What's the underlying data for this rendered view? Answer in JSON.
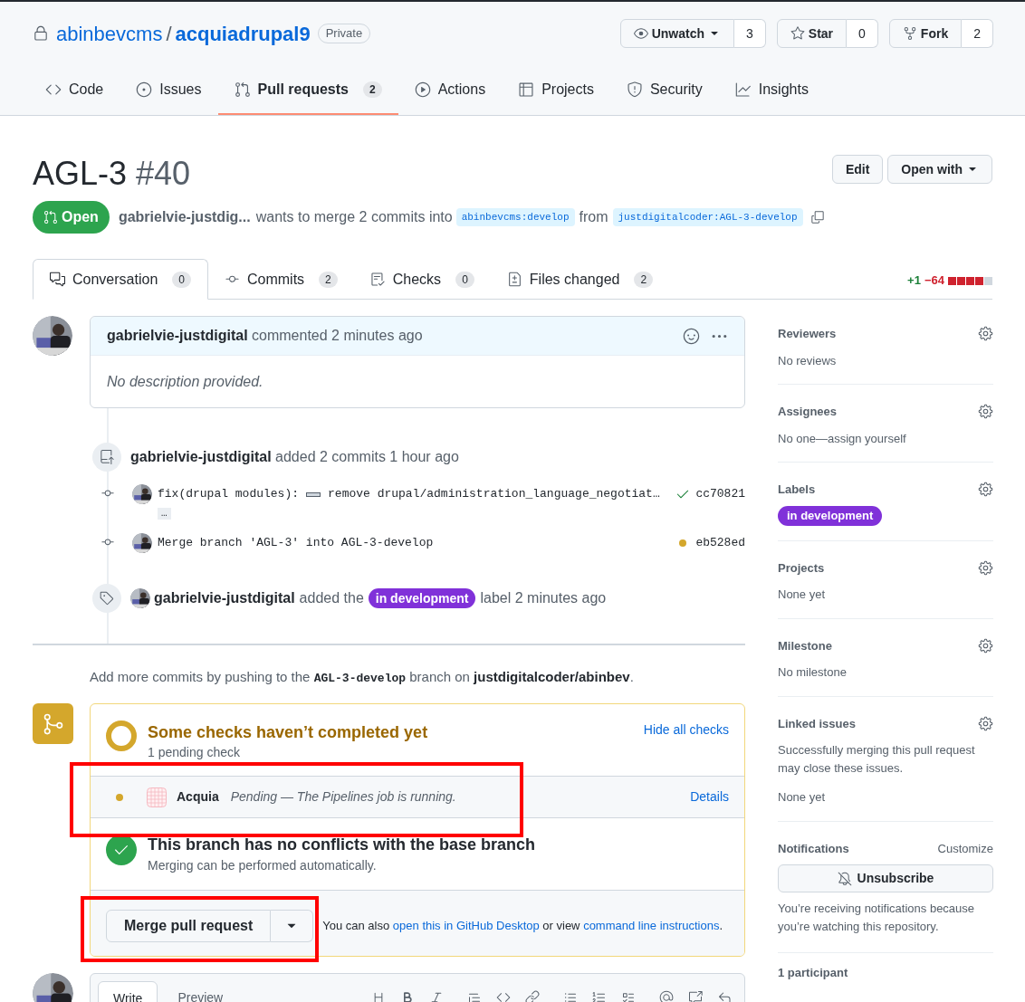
{
  "repo": {
    "owner": "abinbevcms",
    "separator": "/",
    "name": "acquiadrupal9",
    "visibility": "Private"
  },
  "repo_actions": [
    {
      "kind": "watch",
      "label": "Unwatch",
      "count": "3"
    },
    {
      "kind": "star",
      "label": "Star",
      "count": "0"
    },
    {
      "kind": "fork",
      "label": "Fork",
      "count": "2"
    }
  ],
  "repo_tabs": [
    {
      "kind": "code",
      "label": "Code",
      "selected": false
    },
    {
      "kind": "issues",
      "label": "Issues",
      "selected": false
    },
    {
      "kind": "pulls",
      "label": "Pull requests",
      "count": "2",
      "selected": true
    },
    {
      "kind": "actions",
      "label": "Actions",
      "selected": false
    },
    {
      "kind": "projects",
      "label": "Projects",
      "selected": false
    },
    {
      "kind": "security",
      "label": "Security",
      "selected": false
    },
    {
      "kind": "insights",
      "label": "Insights",
      "selected": false
    }
  ],
  "pr": {
    "title": "AGL-3",
    "number": "#40",
    "status": "Open",
    "author": "gabrielvie-justdig...",
    "merge_text": "wants to merge 2 commits into",
    "base": "abinbevcms:develop",
    "from_text": "from",
    "head": "justdigitalcoder:AGL-3-develop",
    "edit_button": "Edit",
    "open_with_button": "Open with"
  },
  "pr_tabs": [
    {
      "kind": "conversation",
      "label": "Conversation",
      "count": "0",
      "selected": true
    },
    {
      "kind": "commits",
      "label": "Commits",
      "count": "2",
      "selected": false
    },
    {
      "kind": "checks",
      "label": "Checks",
      "count": "0",
      "selected": false
    },
    {
      "kind": "files",
      "label": "Files changed",
      "count": "2",
      "selected": false
    }
  ],
  "diffstat": {
    "additions": "+1",
    "deletions": "−64",
    "blocks": [
      {
        "kind": "deleted"
      },
      {
        "kind": "deleted"
      },
      {
        "kind": "deleted"
      },
      {
        "kind": "deleted"
      },
      {
        "kind": "neutral"
      }
    ]
  },
  "comment": {
    "author": "gabrielvie-justdigital",
    "action": "commented 2 minutes ago",
    "body": "No description provided."
  },
  "commits_event": {
    "author": "gabrielvie-justdigital",
    "text": "added 2 commits 1 hour ago"
  },
  "commits": [
    {
      "message_prefix": "fix(drupal modules):",
      "message": "remove drupal/administration_language_negotiat…",
      "more": "…",
      "kind": "success",
      "sha": "cc70821"
    },
    {
      "message": "Merge branch 'AGL-3' into AGL-3-develop",
      "kind": "pending",
      "sha": "eb528ed"
    }
  ],
  "label_event": {
    "author": "gabrielvie-justdigital",
    "before": "added the",
    "label": "in development",
    "color": "#8031d9",
    "after": "label 2 minutes ago"
  },
  "push_hint": [
    {
      "kind": "text",
      "text": "Add more commits by pushing to the "
    },
    {
      "kind": "code",
      "text": "AGL-3-develop"
    },
    {
      "kind": "text",
      "text": " branch on "
    },
    {
      "kind": "bold",
      "text": "justdigitalcoder/abinbev"
    },
    {
      "kind": "text",
      "text": "."
    }
  ],
  "checks": {
    "title": "Some checks haven’t completed yet",
    "subtitle": "1 pending check",
    "toggle": "Hide all checks",
    "items": [
      {
        "name": "Acquia",
        "description": "Pending — The Pipelines job is running.",
        "link": "Details",
        "kind": "pending"
      }
    ]
  },
  "conflicts": {
    "title": "This branch has no conflicts with the base branch",
    "subtitle": "Merging can be performed automatically."
  },
  "merge": {
    "button": "Merge pull request",
    "note_before": "You can also ",
    "link_desktop": "open this in GitHub Desktop",
    "note_middle": " or view ",
    "link_cli": "command line instructions",
    "note_after": "."
  },
  "editor": {
    "tabs": [
      {
        "label": "Write",
        "selected": true
      },
      {
        "label": "Preview",
        "selected": false
      }
    ]
  },
  "sidebar": [
    {
      "title": "Reviewers",
      "kind": "text",
      "value": "No reviews"
    },
    {
      "title": "Assignees",
      "kind": "text",
      "value": "No one—assign yourself"
    },
    {
      "title": "Labels",
      "kind": "label",
      "value": "in development",
      "color": "#8031d9"
    },
    {
      "title": "Projects",
      "kind": "text",
      "value": "None yet"
    },
    {
      "title": "Milestone",
      "kind": "text",
      "value": "No milestone"
    },
    {
      "title": "Linked issues",
      "kind": "linked",
      "note": "Successfully merging this pull request may close these issues.",
      "value": "None yet"
    }
  ],
  "notifications": {
    "title": "Notifications",
    "customize": "Customize",
    "button": "Unsubscribe",
    "note": "You’re receiving notifications because you’re watching this repository."
  },
  "participants": {
    "title": "1 participant"
  },
  "annotations": [
    {
      "kind": "rectangle",
      "color": "#ff0000"
    },
    {
      "kind": "rectangle",
      "color": "#ff0000"
    }
  ]
}
